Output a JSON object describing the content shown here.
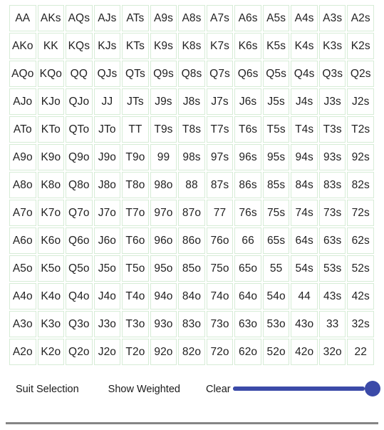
{
  "grid": {
    "name": "poker-hand-range-grid",
    "rows": 13,
    "cols": 13,
    "cell_border_color": "#d6ecd6",
    "cell_background": "#ffffff",
    "text_color": "#222222",
    "cells": [
      [
        "AA",
        "AKs",
        "AQs",
        "AJs",
        "ATs",
        "A9s",
        "A8s",
        "A7s",
        "A6s",
        "A5s",
        "A4s",
        "A3s",
        "A2s"
      ],
      [
        "AKo",
        "KK",
        "KQs",
        "KJs",
        "KTs",
        "K9s",
        "K8s",
        "K7s",
        "K6s",
        "K5s",
        "K4s",
        "K3s",
        "K2s"
      ],
      [
        "AQo",
        "KQo",
        "QQ",
        "QJs",
        "QTs",
        "Q9s",
        "Q8s",
        "Q7s",
        "Q6s",
        "Q5s",
        "Q4s",
        "Q3s",
        "Q2s"
      ],
      [
        "AJo",
        "KJo",
        "QJo",
        "JJ",
        "JTs",
        "J9s",
        "J8s",
        "J7s",
        "J6s",
        "J5s",
        "J4s",
        "J3s",
        "J2s"
      ],
      [
        "ATo",
        "KTo",
        "QTo",
        "JTo",
        "TT",
        "T9s",
        "T8s",
        "T7s",
        "T6s",
        "T5s",
        "T4s",
        "T3s",
        "T2s"
      ],
      [
        "A9o",
        "K9o",
        "Q9o",
        "J9o",
        "T9o",
        "99",
        "98s",
        "97s",
        "96s",
        "95s",
        "94s",
        "93s",
        "92s"
      ],
      [
        "A8o",
        "K8o",
        "Q8o",
        "J8o",
        "T8o",
        "98o",
        "88",
        "87s",
        "86s",
        "85s",
        "84s",
        "83s",
        "82s"
      ],
      [
        "A7o",
        "K7o",
        "Q7o",
        "J7o",
        "T7o",
        "97o",
        "87o",
        "77",
        "76s",
        "75s",
        "74s",
        "73s",
        "72s"
      ],
      [
        "A6o",
        "K6o",
        "Q6o",
        "J6o",
        "T6o",
        "96o",
        "86o",
        "76o",
        "66",
        "65s",
        "64s",
        "63s",
        "62s"
      ],
      [
        "A5o",
        "K5o",
        "Q5o",
        "J5o",
        "T5o",
        "95o",
        "85o",
        "75o",
        "65o",
        "55",
        "54s",
        "53s",
        "52s"
      ],
      [
        "A4o",
        "K4o",
        "Q4o",
        "J4o",
        "T4o",
        "94o",
        "84o",
        "74o",
        "64o",
        "54o",
        "44",
        "43s",
        "42s"
      ],
      [
        "A3o",
        "K3o",
        "Q3o",
        "J3o",
        "T3o",
        "93o",
        "83o",
        "73o",
        "63o",
        "53o",
        "43o",
        "33",
        "32s"
      ],
      [
        "A2o",
        "K2o",
        "Q2o",
        "J2o",
        "T2o",
        "92o",
        "82o",
        "72o",
        "62o",
        "52o",
        "42o",
        "32o",
        "22"
      ]
    ]
  },
  "controls": {
    "suit_selection_label": "Suit Selection",
    "show_weighted_label": "Show Weighted",
    "clear_label": "Clear"
  },
  "slider": {
    "name": "weight-slider",
    "value": 100,
    "min": 0,
    "max": 100,
    "color": "#3b4aa8"
  },
  "divider": {
    "color": "#858585"
  }
}
